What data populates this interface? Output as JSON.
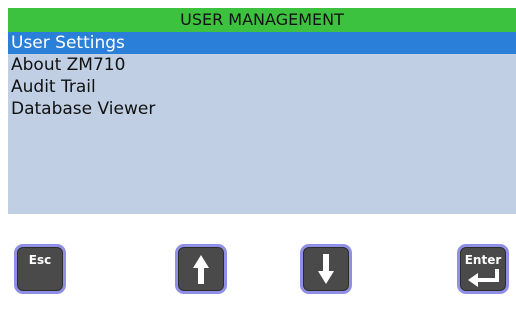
{
  "header": {
    "title": "USER MANAGEMENT"
  },
  "menu": {
    "items": [
      {
        "label": "User Settings",
        "selected": true
      },
      {
        "label": "About ZM710",
        "selected": false
      },
      {
        "label": "Audit Trail",
        "selected": false
      },
      {
        "label": "Database Viewer",
        "selected": false
      }
    ]
  },
  "keys": {
    "esc_label": "Esc",
    "up_icon": "up-arrow-icon",
    "down_icon": "down-arrow-icon",
    "enter_label": "Enter",
    "enter_icon": "return-arrow-icon"
  },
  "colors": {
    "title_bar": "#3cc23e",
    "list_background": "#c0cfe3",
    "selection": "#2a7fd8",
    "key_face": "#4a4a4a",
    "key_border": "#8f8fe6"
  }
}
